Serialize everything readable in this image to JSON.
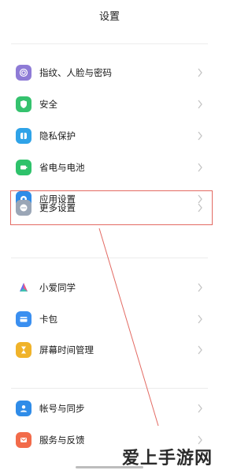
{
  "header": {
    "title": "设置"
  },
  "groups": [
    {
      "items": [
        {
          "label": "指纹、人脸与密码",
          "icon": "fingerprint-icon",
          "color": "#8e7bd6"
        },
        {
          "label": "安全",
          "icon": "shield-icon",
          "color": "#35c26e"
        },
        {
          "label": "隐私保护",
          "icon": "privacy-icon",
          "color": "#2fa3e8"
        },
        {
          "label": "省电与电池",
          "icon": "battery-icon",
          "color": "#2ec26b"
        },
        {
          "label": "应用设置",
          "icon": "gear-icon",
          "color": "#2f8ce8"
        },
        {
          "label": "更多设置",
          "icon": "more-icon",
          "color": "#9aa6b6"
        }
      ]
    },
    {
      "items": [
        {
          "label": "小爱同学",
          "icon": "xiaoai-icon",
          "color": "#f2f2f2"
        },
        {
          "label": "卡包",
          "icon": "card-icon",
          "color": "#3a8ff0"
        },
        {
          "label": "屏幕时间管理",
          "icon": "hourglass-icon",
          "color": "#f0b32a"
        }
      ]
    },
    {
      "items": [
        {
          "label": "帐号与同步",
          "icon": "account-icon",
          "color": "#2f8ce8"
        },
        {
          "label": "服务与反馈",
          "icon": "feedback-icon",
          "color": "#f26b4a"
        }
      ]
    }
  ],
  "watermark": {
    "text": "爱上手游网"
  }
}
